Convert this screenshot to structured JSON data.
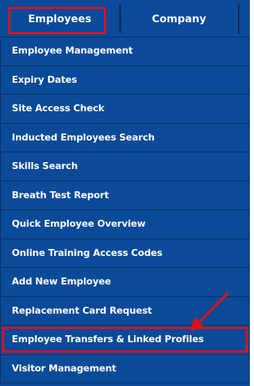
{
  "tabs": [
    {
      "label": "Employees",
      "active": true
    },
    {
      "label": "Company",
      "active": false
    }
  ],
  "menu": {
    "items": [
      {
        "label": "Employee Management"
      },
      {
        "label": "Expiry Dates"
      },
      {
        "label": "Site Access Check"
      },
      {
        "label": "Inducted Employees Search"
      },
      {
        "label": "Skills Search"
      },
      {
        "label": "Breath Test Report"
      },
      {
        "label": "Quick Employee Overview"
      },
      {
        "label": "Online Training Access Codes"
      },
      {
        "label": "Add New Employee"
      },
      {
        "label": "Replacement Card Request"
      },
      {
        "label": "Employee Transfers & Linked Profiles"
      },
      {
        "label": "Visitor Management"
      }
    ]
  },
  "colors": {
    "panel": "#0a4a98",
    "divider": "#0e2c5e",
    "text": "#ffffff",
    "annotation": "#e0101a"
  },
  "annotations": {
    "highlighted_tab": "Employees",
    "highlighted_item": "Employee Transfers & Linked Profiles",
    "arrow": "red-arrow-icon"
  }
}
